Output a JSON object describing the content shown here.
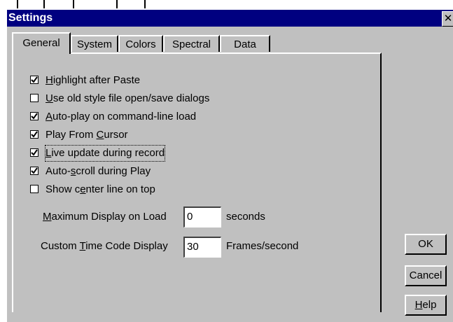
{
  "window": {
    "title": "Settings",
    "close_glyph": "✕"
  },
  "tabs": [
    {
      "label": "General",
      "active": true
    },
    {
      "label": "System"
    },
    {
      "label": "Colors"
    },
    {
      "label": "Spectral"
    },
    {
      "label": "Data"
    }
  ],
  "checkboxes": [
    {
      "pre": "",
      "u": "H",
      "post": "ighlight after Paste",
      "checked": true
    },
    {
      "pre": "",
      "u": "U",
      "post": "se old style file open/save dialogs",
      "checked": false
    },
    {
      "pre": "",
      "u": "A",
      "post": "uto-play on command-line load",
      "checked": true
    },
    {
      "pre": "Play From ",
      "u": "C",
      "post": "ursor",
      "checked": true
    },
    {
      "pre": "",
      "u": "L",
      "post": "ive update during record",
      "checked": true,
      "focused": true
    },
    {
      "pre": "Auto-",
      "u": "s",
      "post": "croll during Play",
      "checked": true
    },
    {
      "pre": "Show c",
      "u": "e",
      "post": "nter line on top",
      "checked": false
    }
  ],
  "fields": {
    "max_display": {
      "pre": "",
      "u": "M",
      "post": "aximum Display on Load",
      "value": "0",
      "unit": "seconds"
    },
    "time_code": {
      "pre": "Custom ",
      "u": "T",
      "post": "ime Code Display",
      "value": "30",
      "unit": "Frames/second"
    }
  },
  "buttons": {
    "ok": {
      "pre": "",
      "u": "",
      "post": "OK"
    },
    "cancel": {
      "pre": "",
      "u": "",
      "post": "Cancel"
    },
    "help": {
      "pre": "",
      "u": "H",
      "post": "elp"
    }
  }
}
